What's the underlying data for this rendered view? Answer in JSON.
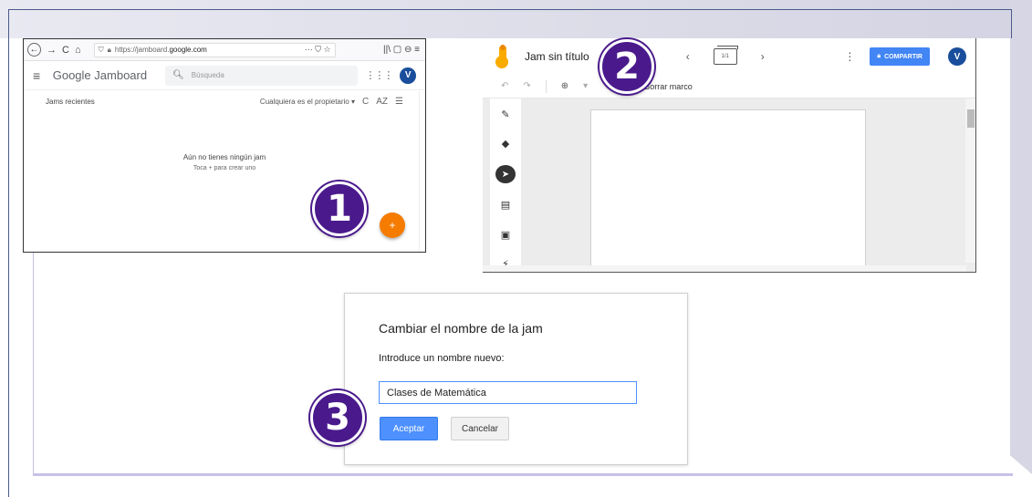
{
  "colors": {
    "badge": "#4a1a8c",
    "accent_blue": "#4285f4",
    "fab_orange": "#f57c00",
    "avatar": "#1a4e9c"
  },
  "steps": [
    "1",
    "2",
    "3"
  ],
  "browser": {
    "url_prefix": "https://",
    "url_host": "jamboard.",
    "url_domain": "google.com",
    "url_icons": "··· ⛉ ☆",
    "tools": "||\\ ▢ ⊖ ≡",
    "icons": [
      "back-icon",
      "forward-icon",
      "reload-icon",
      "home-icon",
      "shield-icon",
      "lock-icon"
    ]
  },
  "jamboard_home": {
    "logo_word": "Google",
    "logo_product": "Jamboard",
    "search_placeholder": "Búsqueda",
    "avatar": "V",
    "recent_label": "Jams recientes",
    "owner_filter": "Cualquiera es el propietario",
    "empty_title": "Aún no tienes ningún jam",
    "empty_subtitle": "Toca + para crear uno",
    "fab_label": "+"
  },
  "jam_editor": {
    "title": "Jam sin título",
    "frame_indicator": "1/1",
    "prev": "‹",
    "next": "›",
    "more": "⋮",
    "share_label": "COMPARTIR",
    "avatar": "V",
    "undo": "↶",
    "redo": "↷",
    "zoom": "⊕",
    "zoom_caret": "▾",
    "clear_frame": "Borrar marco",
    "tools": [
      {
        "name": "pen-icon",
        "glyph": "✎"
      },
      {
        "name": "eraser-icon",
        "glyph": "◆"
      },
      {
        "name": "select-icon",
        "glyph": "➤"
      },
      {
        "name": "sticky-note-icon",
        "glyph": "▤"
      },
      {
        "name": "image-icon",
        "glyph": "▣"
      },
      {
        "name": "laser-icon",
        "glyph": "⚡"
      }
    ]
  },
  "rename_dialog": {
    "title": "Cambiar el nombre de la jam",
    "label": "Introduce un nombre nuevo:",
    "input_value": "Clases de Matemática",
    "accept_label": "Aceptar",
    "cancel_label": "Cancelar"
  }
}
